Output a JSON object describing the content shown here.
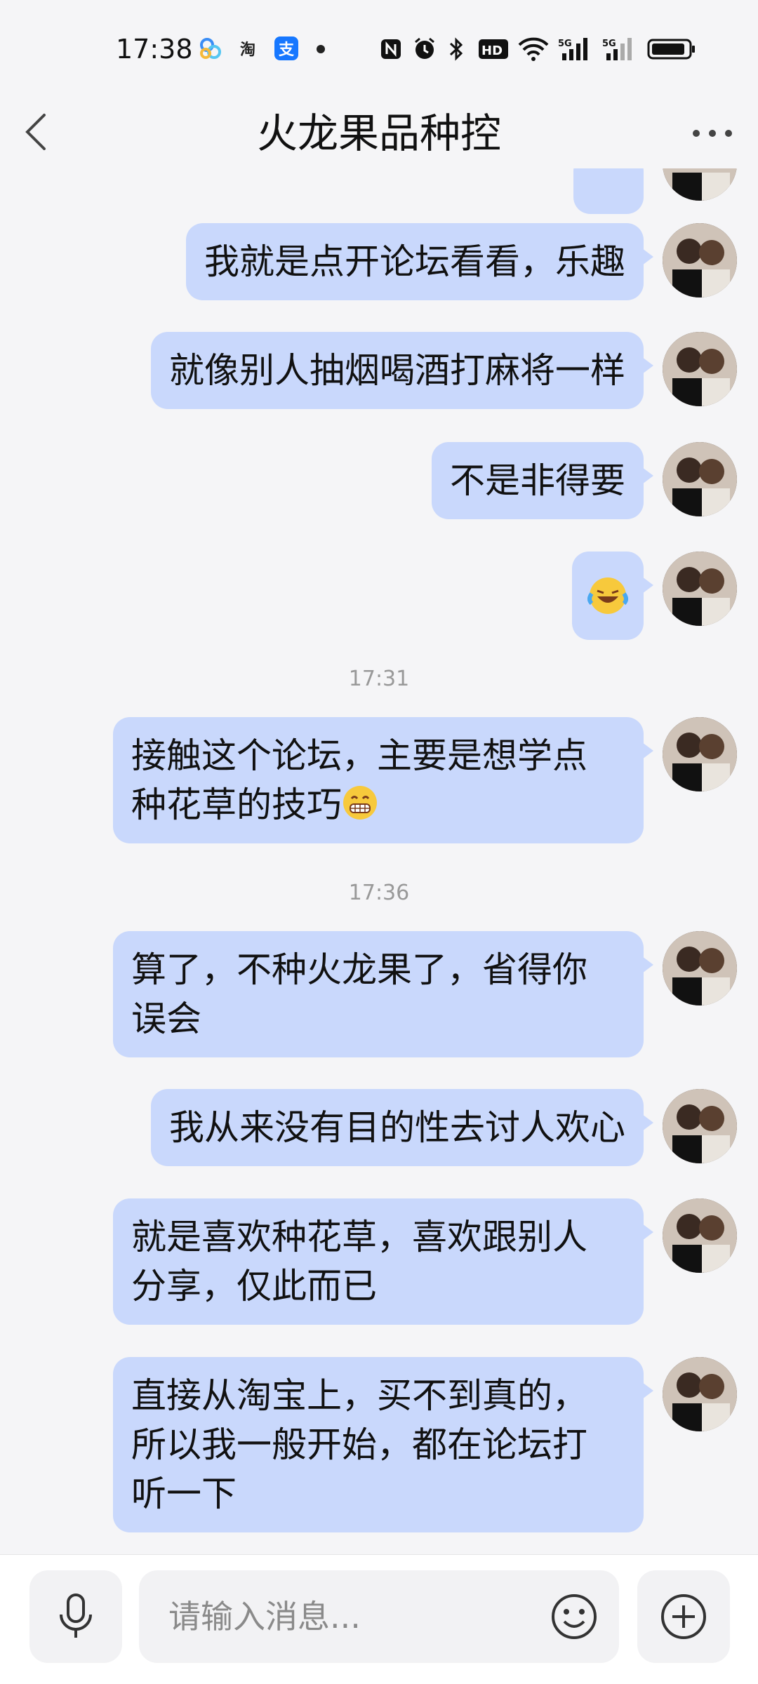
{
  "status_bar": {
    "time": "17:38",
    "apps": [
      "baidu-netdisk-icon",
      "taobao-icon",
      "alipay-icon"
    ],
    "taobao_glyph": "淘",
    "alipay_glyph": "支",
    "hd_label": "HD",
    "signal1_label": "5G",
    "signal2_label": "5G"
  },
  "header": {
    "title": "火龙果品种控"
  },
  "messages": [
    {
      "text": "我就是点开论坛看看，乐趣"
    },
    {
      "text": "就像别人抽烟喝酒打麻将一样"
    },
    {
      "text": "不是非得要"
    },
    {
      "emoji": "laughing-crying-emoji"
    },
    {
      "timestamp": "17:31"
    },
    {
      "line1": "接触这个论坛，主要是想学点",
      "line2": "种花草的技巧",
      "emoji": "grinning-emoji"
    },
    {
      "timestamp": "17:36"
    },
    {
      "line1": "算了，不种火龙果了，省得你",
      "line2": "误会"
    },
    {
      "text": "我从来没有目的性去讨人欢心"
    },
    {
      "line1": "就是喜欢种花草，喜欢跟别人",
      "line2": "分享，仅此而已"
    },
    {
      "line1": "直接从淘宝上，买不到真的，",
      "line2": "所以我一般开始，都在论坛打",
      "line3": "听一下"
    }
  ],
  "input": {
    "placeholder": "请输入消息..."
  },
  "colors": {
    "bubble": "#c9d8fc",
    "background": "#f5f5f7"
  }
}
